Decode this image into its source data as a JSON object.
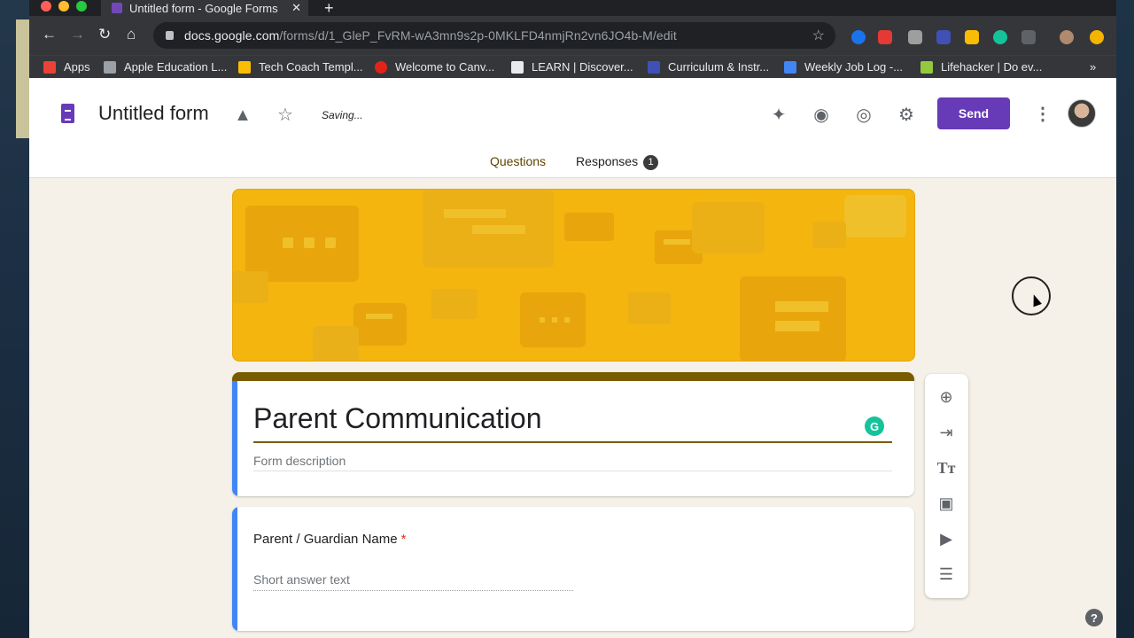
{
  "browser": {
    "tab_title": "Untitled form - Google Forms",
    "url_domain": "docs.google.com",
    "url_path": "/forms/d/1_GleP_FvRM-wA3mn9s2p-0MKLFD4nmjRn2vn6JO4b-M/edit"
  },
  "bookmarks": [
    {
      "label": "Apps",
      "color": "#ea4335"
    },
    {
      "label": "Apple Education L...",
      "color": "#9aa0a6"
    },
    {
      "label": "Tech Coach Templ...",
      "color": "#fbbc04"
    },
    {
      "label": "Welcome to Canv...",
      "color": "#e2231a"
    },
    {
      "label": "LEARN | Discover...",
      "color": "#e8eaed"
    },
    {
      "label": "Curriculum & Instr...",
      "color": "#3f51b5"
    },
    {
      "label": "Weekly Job Log -...",
      "color": "#4285f4"
    },
    {
      "label": "Lifehacker | Do ev...",
      "color": "#94c93d"
    }
  ],
  "bookmarks_more": "»",
  "header": {
    "form_title": "Untitled form",
    "saving": "Saving...",
    "send_label": "Send",
    "tabs": {
      "questions": "Questions",
      "responses": "Responses",
      "responses_count": "1"
    }
  },
  "title_card": {
    "title": "Parent Communication",
    "description_placeholder": "Form description",
    "grammarly": "G"
  },
  "question": {
    "title": "Parent / Guardian Name",
    "required_mark": "*",
    "hint": "Short answer text"
  },
  "help": "?",
  "colors": {
    "accent": "#673ab7",
    "theme": "#f3b50e",
    "theme_dark": "#7a5c00",
    "background": "#f5f1e8"
  }
}
